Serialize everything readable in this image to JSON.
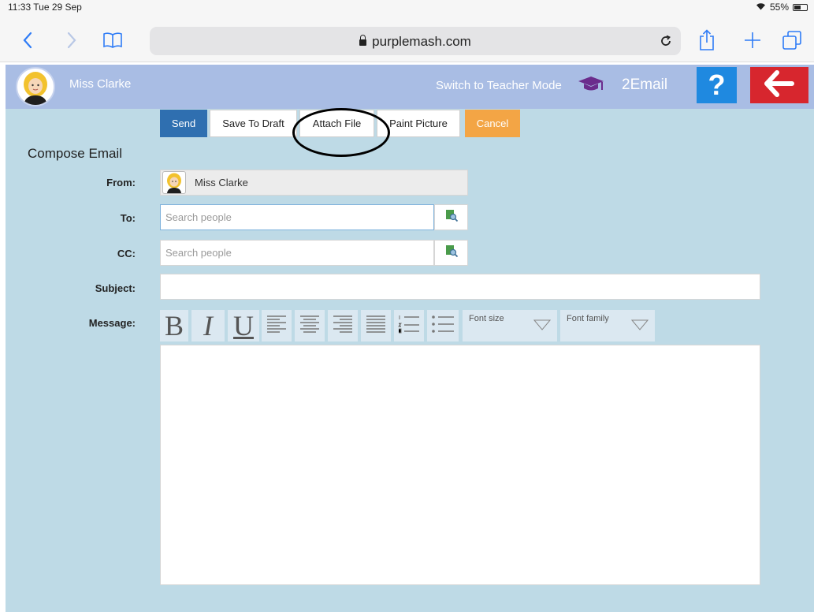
{
  "status": {
    "time": "11:33  Tue 29 Sep",
    "battery": "55%",
    "battery_level": 0.55
  },
  "browser": {
    "url": "purplemash.com"
  },
  "header": {
    "user_name": "Miss Clarke",
    "teacher_mode_label": "Switch to Teacher Mode",
    "app_title": "2Email",
    "help_label": "?"
  },
  "toolbar": {
    "send": "Send",
    "save_draft": "Save To Draft",
    "attach_file": "Attach File",
    "paint_picture": "Paint Picture",
    "cancel": "Cancel"
  },
  "compose": {
    "title": "Compose Email",
    "from_label": "From:",
    "from_value": "Miss Clarke",
    "to_label": "To:",
    "to_placeholder": "Search people",
    "cc_label": "CC:",
    "cc_placeholder": "Search people",
    "subject_label": "Subject:",
    "message_label": "Message:"
  },
  "editor": {
    "bold": "B",
    "italic": "I",
    "underline": "U",
    "font_size": "Font size",
    "font_family": "Font family"
  },
  "colors": {
    "header_bg": "#a9bde4",
    "main_bg": "#bedae6",
    "send": "#2f6fb0",
    "cancel": "#f3a545",
    "help": "#1f89e0",
    "back": "#d7262e"
  }
}
